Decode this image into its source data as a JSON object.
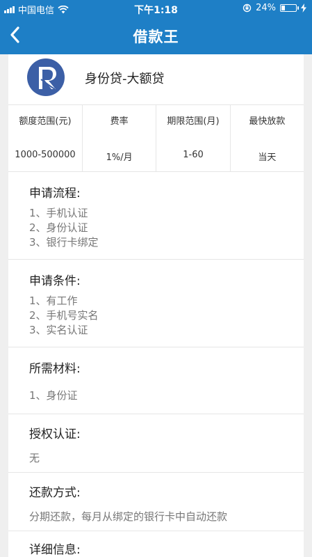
{
  "status_bar": {
    "carrier": "中国电信",
    "time": "下午1:18",
    "battery": "24%",
    "battery_level": 0.24
  },
  "nav": {
    "title": "借款王"
  },
  "product": {
    "name": "身份贷-大额贷",
    "logo_color": "#3c5fa6",
    "stats": [
      {
        "label": "额度范围(元)",
        "value": "1000-500000"
      },
      {
        "label": "费率",
        "value": "1%/月"
      },
      {
        "label": "期限范围(月)",
        "value": "1-60"
      },
      {
        "label": "最快放款",
        "value": "当天"
      }
    ]
  },
  "sections": {
    "flow": {
      "title": "申请流程:",
      "lines": [
        "1、手机认证",
        "2、身份认证",
        "3、银行卡绑定"
      ]
    },
    "conditions": {
      "title": "申请条件:",
      "lines": [
        "1、有工作",
        "2、手机号实名",
        "3、实名认证"
      ]
    },
    "materials": {
      "title": "所需材料:",
      "lines": [
        "1、身份证"
      ]
    },
    "authorization": {
      "title": "授权认证:",
      "lines": [
        "无"
      ]
    },
    "repayment": {
      "title": "还款方式:",
      "lines": [
        "分期还款，每月从绑定的银行卡中自动还款"
      ]
    },
    "detail": {
      "title": "详细信息:"
    }
  },
  "colors": {
    "brand": "#1e7fc6",
    "card_bg": "#ffffff",
    "page_bg": "#efefef"
  }
}
